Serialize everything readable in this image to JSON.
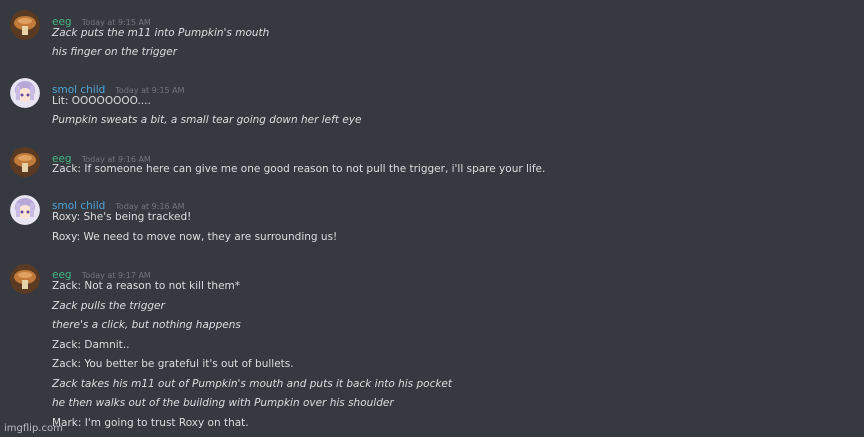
{
  "colors": {
    "background": "#36393f",
    "eeg_name": "#43b581",
    "smol_name": "#4fa3d9",
    "timestamp": "#72767d",
    "text": "#dcddde"
  },
  "messages": [
    {
      "user": "eeg",
      "time": "Today at 9:15 AM",
      "avatar": "mushroom-avatar",
      "lines": [
        {
          "text": "Zack puts the m11 into Pumpkin's mouth",
          "italic": true
        },
        {
          "text": "his finger on the trigger",
          "italic": true
        }
      ]
    },
    {
      "user": "smol child",
      "time": "Today at 9:15 AM",
      "avatar": "anime-girl-avatar",
      "lines": [
        {
          "text": "Lit: OOOOOOOO....",
          "italic": false
        },
        {
          "text": "Pumpkin sweats a bit, a small tear going down her left eye",
          "italic": true
        }
      ]
    },
    {
      "user": "eeg",
      "time": "Today at 9:16 AM",
      "avatar": "mushroom-avatar",
      "lines": [
        {
          "text": "Zack: If someone here can give me one good reason to not pull the trigger, i'll spare your life.",
          "italic": false
        }
      ]
    },
    {
      "user": "smol child",
      "time": "Today at 9:16 AM",
      "avatar": "anime-girl-avatar",
      "lines": [
        {
          "text": "Roxy: She's being tracked!",
          "italic": false
        },
        {
          "text": "Roxy: We need to move now, they are surrounding us!",
          "italic": false
        }
      ]
    },
    {
      "user": "eeg",
      "time": "Today at 9:17 AM",
      "avatar": "mushroom-avatar",
      "lines": [
        {
          "text": "Zack: Not a reason to not kill them*",
          "italic": false
        },
        {
          "text": "Zack pulls the trigger",
          "italic": true
        },
        {
          "text": "there's a click, but nothing happens",
          "italic": true
        },
        {
          "text": "Zack: Damnit..",
          "italic": false
        },
        {
          "text": "Zack: You better be grateful it's out of bullets.",
          "italic": false
        },
        {
          "text": "Zack takes his m11 out of Pumpkin's mouth and puts it back into his pocket",
          "italic": true
        },
        {
          "text": "he then walks out of the building with Pumpkin over his shoulder",
          "italic": true
        },
        {
          "text": "Mark: I'm going to trust Roxy on that.",
          "italic": false
        }
      ]
    }
  ],
  "watermark": "imgflip.com"
}
